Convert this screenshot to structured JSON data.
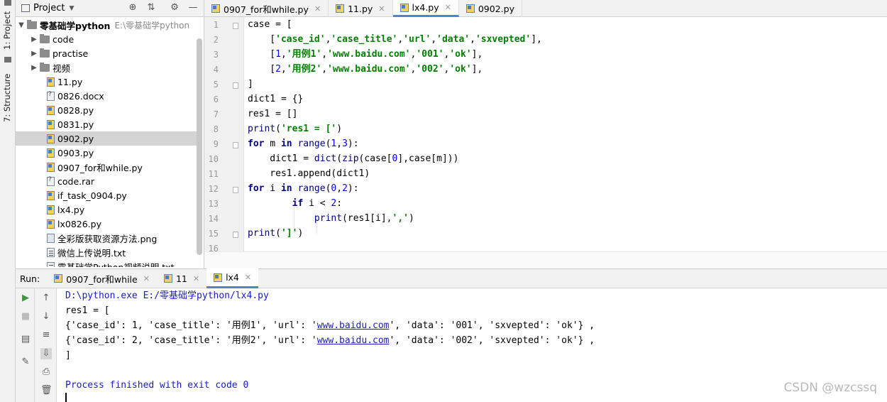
{
  "sidebar": {
    "project_tab": "1: Project",
    "structure_tab": "7: Structure"
  },
  "project": {
    "title": "Project",
    "root": {
      "name": "零基础学python",
      "path": "E:\\零基础学python"
    },
    "items": [
      {
        "name": "code",
        "type": "folder"
      },
      {
        "name": "practise",
        "type": "folder"
      },
      {
        "name": "视频",
        "type": "folder"
      },
      {
        "name": "11.py",
        "type": "py"
      },
      {
        "name": "0826.docx",
        "type": "unknown"
      },
      {
        "name": "0828.py",
        "type": "py"
      },
      {
        "name": "0831.py",
        "type": "py"
      },
      {
        "name": "0902.py",
        "type": "py",
        "selected": true
      },
      {
        "name": "0903.py",
        "type": "py"
      },
      {
        "name": "0907_for和while.py",
        "type": "py"
      },
      {
        "name": "code.rar",
        "type": "unknown"
      },
      {
        "name": "if_task_0904.py",
        "type": "py"
      },
      {
        "name": "lx4.py",
        "type": "py"
      },
      {
        "name": "lx0826.py",
        "type": "py"
      },
      {
        "name": "全彩版获取资源方法.png",
        "type": "image"
      },
      {
        "name": "微信上传说明.txt",
        "type": "text"
      },
      {
        "name": "零基础学Python视频说明.txt",
        "type": "text"
      }
    ]
  },
  "editor": {
    "tabs": [
      {
        "label": "0907_for和while.py",
        "active": false
      },
      {
        "label": "11.py",
        "active": false
      },
      {
        "label": "lx4.py",
        "active": true
      },
      {
        "label": "0902.py",
        "active": false
      }
    ],
    "line_numbers": [
      "1",
      "2",
      "3",
      "4",
      "5",
      "6",
      "7",
      "8",
      "9",
      "10",
      "11",
      "12",
      "13",
      "14",
      "15",
      "16"
    ],
    "lines": [
      "case = [",
      "    ['case_id','case_title','url','data','sxvepted'],",
      "    [1,'用例1','www.baidu.com','001','ok'],",
      "    [2,'用例2','www.baidu.com','002','ok'],",
      "]",
      "dict1 = {}",
      "res1 = []",
      "print('res1 = [')",
      "for m in range(1,3):",
      "    dict1 = dict(zip(case[0],case[m]))",
      "    res1.append(dict1)",
      "for i in range(0,2):",
      "        if i < 2:",
      "            print(res1[i],',')",
      "print(']')",
      ""
    ]
  },
  "run": {
    "label": "Run:",
    "tabs": [
      {
        "label": "0907_for和while",
        "active": false
      },
      {
        "label": "11",
        "active": false
      },
      {
        "label": "lx4",
        "active": true
      }
    ],
    "output": {
      "command": "D:\\python.exe E:/零基础学python/lx4.py",
      "line1": "res1 = [",
      "row1_a": "{'case_id': 1, 'case_title': '用例1', 'url': '",
      "row1_link": "www.baidu.com",
      "row1_b": "', 'data': '001', 'sxvepted': 'ok'} ,",
      "row2_a": "{'case_id': 2, 'case_title': '用例2', 'url': '",
      "row2_link": "www.baidu.com",
      "row2_b": "', 'data': '002', 'sxvepted': 'ok'} ,",
      "line4": "]",
      "finished": "Process finished with exit code 0"
    }
  },
  "watermark": "CSDN @wzcssq",
  "colors": {
    "keyword": "#000080",
    "string": "#008000",
    "number": "#0000ff",
    "accent": "#4a86c8",
    "console_blue": "#1b1bc8"
  }
}
